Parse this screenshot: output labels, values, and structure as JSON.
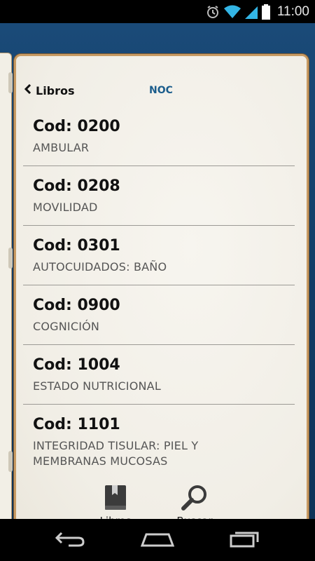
{
  "status_bar": {
    "time": "11:00"
  },
  "nav": {
    "back_label": "Libros",
    "title": "NOC"
  },
  "items": [
    {
      "code": "Cod: 0200",
      "name": "AMBULAR"
    },
    {
      "code": "Cod: 0208",
      "name": "MOVILIDAD"
    },
    {
      "code": "Cod: 0301",
      "name": "AUTOCUIDADOS: BAÑO"
    },
    {
      "code": "Cod: 0900",
      "name": "COGNICIÓN"
    },
    {
      "code": "Cod: 1004",
      "name": "ESTADO NUTRICIONAL"
    },
    {
      "code": "Cod: 1101",
      "name": "INTEGRIDAD TISULAR: PIEL Y MEMBRANAS MUCOSAS"
    }
  ],
  "tabs": {
    "books_label": "Libros",
    "search_label": "Buscar"
  },
  "colors": {
    "accent": "#1b5d8c",
    "cover": "#123d67",
    "page": "#f5f2eb"
  }
}
